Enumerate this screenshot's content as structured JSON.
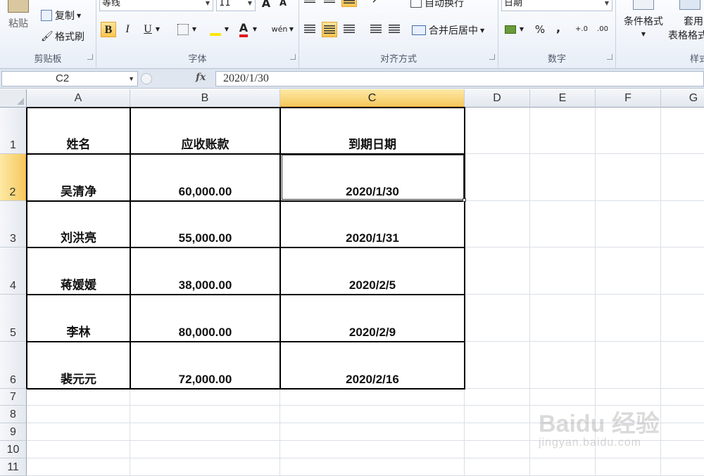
{
  "ribbon": {
    "clipboard": {
      "paste_label": "粘贴",
      "copy_label": "复制",
      "format_painter_label": "格式刷",
      "group_label": "剪贴板"
    },
    "font": {
      "font_name": "等线",
      "font_size": "11",
      "bold": "B",
      "italic": "I",
      "underline": "U",
      "font_color_glyph": "A",
      "phonetic_glyph": "wén",
      "group_label": "字体"
    },
    "alignment": {
      "wrap_text_label": "自动换行",
      "merge_center_label": "合并后居中",
      "group_label": "对齐方式"
    },
    "number": {
      "format_value": "日期",
      "percent_glyph": "%",
      "comma_glyph": ",",
      "increase_decimal": "+.0",
      "decrease_decimal": ".00",
      "group_label": "数字"
    },
    "styles": {
      "conditional_label": "条件格式",
      "table_format_label_1": "套用",
      "table_format_label_2": "表格格式",
      "group_label": "样式"
    }
  },
  "formula_bar": {
    "name_box": "C2",
    "fx": "fx",
    "formula": "2020/1/30"
  },
  "columns": [
    "A",
    "B",
    "C",
    "D",
    "E",
    "F",
    "G"
  ],
  "selected_column": "C",
  "rows": [
    "1",
    "2",
    "3",
    "4",
    "5",
    "6",
    "7",
    "8",
    "9",
    "10",
    "11"
  ],
  "selected_row": "2",
  "table": {
    "header": [
      "姓名",
      "应收账款",
      "到期日期"
    ],
    "records": [
      [
        "吴清净",
        "60,000.00",
        "2020/1/30"
      ],
      [
        "刘洪亮",
        "55,000.00",
        "2020/1/31"
      ],
      [
        "蒋媛媛",
        "38,000.00",
        "2020/2/5"
      ],
      [
        "李林",
        "80,000.00",
        "2020/2/9"
      ],
      [
        "裴元元",
        "72,000.00",
        "2020/2/16"
      ]
    ]
  },
  "watermark": {
    "brand": "Baidu 经验",
    "site": "jingyan.baidu.com"
  },
  "colors": {
    "accent": "#f6c85e",
    "selection_border": "#e3a33a",
    "ribbon_bg": "#e8eef7"
  }
}
